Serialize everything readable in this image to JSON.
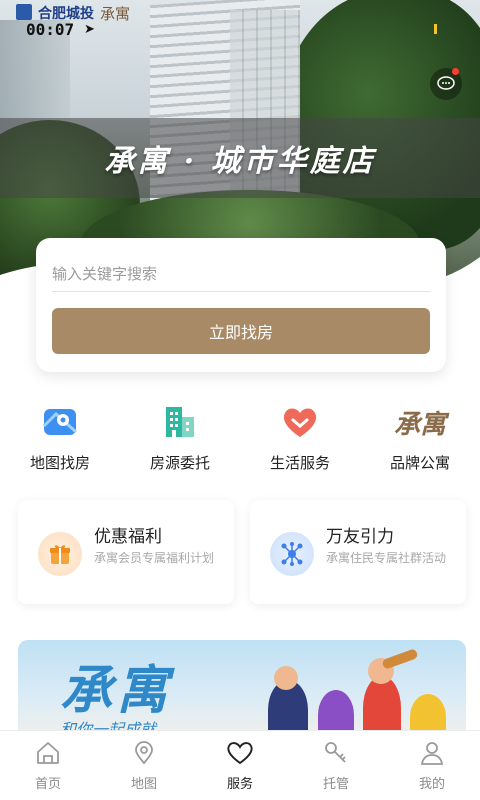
{
  "status_bar": {
    "brand_name": "合肥城投",
    "brand_sub": "承寓",
    "time": "00:07"
  },
  "hero": {
    "title": "承寓 · 城市华庭店"
  },
  "search": {
    "placeholder": "输入关键字搜索",
    "button_label": "立即找房"
  },
  "quick_nav": [
    {
      "label": "地图找房",
      "icon": "map-pin-icon"
    },
    {
      "label": "房源委托",
      "icon": "building-icon"
    },
    {
      "label": "生活服务",
      "icon": "heart-icon"
    },
    {
      "label": "品牌公寓",
      "icon": "brand-logo-icon",
      "glyph": "承寓"
    }
  ],
  "features": [
    {
      "title": "优惠福利",
      "subtitle": "承寓会员专属福利计划",
      "icon": "gift-icon"
    },
    {
      "title": "万友引力",
      "subtitle": "承寓住民专属社群活动",
      "icon": "network-icon"
    }
  ],
  "promo": {
    "brand": "承寓",
    "tagline": "和你一起成就"
  },
  "tabbar": [
    {
      "label": "首页",
      "icon": "home-icon",
      "active": false
    },
    {
      "label": "地图",
      "icon": "location-icon",
      "active": false
    },
    {
      "label": "服务",
      "icon": "heart-outline-icon",
      "active": true
    },
    {
      "label": "托管",
      "icon": "key-icon",
      "active": false
    },
    {
      "label": "我的",
      "icon": "user-icon",
      "active": false
    }
  ],
  "colors": {
    "accent": "#a98a66",
    "map_blue": "#3d8ff0",
    "building_teal": "#2fb8a0",
    "heart_red": "#f06a5a",
    "brand_brown": "#8a6a48"
  }
}
